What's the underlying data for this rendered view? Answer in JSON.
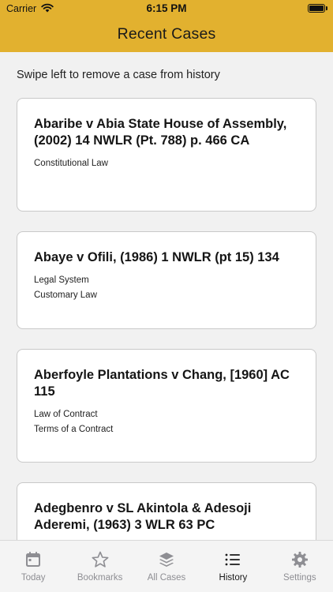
{
  "status": {
    "carrier": "Carrier",
    "time": "6:15 PM"
  },
  "header": {
    "title": "Recent Cases",
    "color": "#e2b12f"
  },
  "hint": "Swipe left to remove a case from history",
  "cases": [
    {
      "title_line1": "Abaribe v Abia State House of Assembly,",
      "title_line2": "(2002) 14 NWLR (Pt. 788) p. 466 CA",
      "tags": [
        "Constitutional Law"
      ]
    },
    {
      "title_line1": "Abaye v Ofili, (1986) 1 NWLR (pt 15) 134",
      "title_line2": "",
      "tags": [
        "Legal System",
        "Customary Law"
      ]
    },
    {
      "title_line1": "Aberfoyle Plantations v Chang, [1960] AC",
      "title_line2": "115",
      "tags": [
        "Law of Contract",
        "Terms of a Contract"
      ]
    },
    {
      "title_line1": "Adegbenro v SL Akintola & Adesoji",
      "title_line2": "Aderemi, (1963) 3 WLR 63 PC",
      "tags": []
    }
  ],
  "tabs": [
    {
      "label": "Today",
      "icon": "calendar-icon",
      "active": false
    },
    {
      "label": "Bookmarks",
      "icon": "star-icon",
      "active": false
    },
    {
      "label": "All Cases",
      "icon": "layers-icon",
      "active": false
    },
    {
      "label": "History",
      "icon": "list-icon",
      "active": true
    },
    {
      "label": "Settings",
      "icon": "gear-icon",
      "active": false
    }
  ]
}
